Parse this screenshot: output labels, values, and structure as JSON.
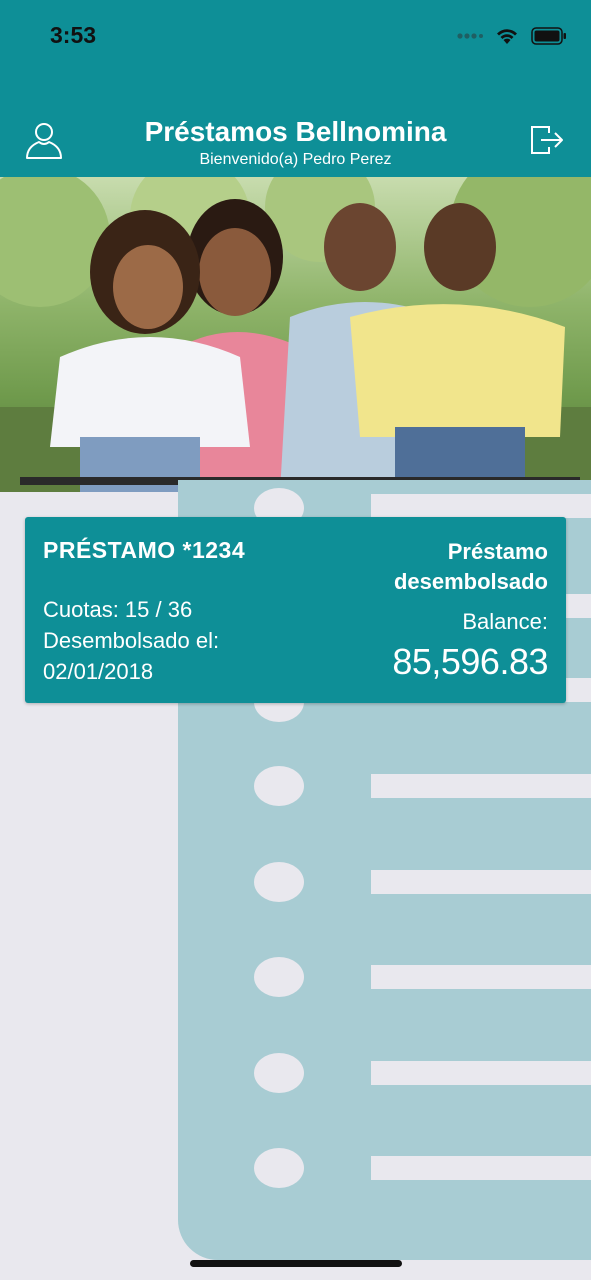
{
  "status_bar": {
    "time": "3:53",
    "icons": [
      "signal-dots-icon",
      "wifi-icon",
      "battery-icon"
    ]
  },
  "header": {
    "title": "Préstamos Bellnomina",
    "subtitle": "Bienvenido(a) Pedro Perez",
    "left_icon": "user-profile-icon",
    "right_icon": "logout-icon"
  },
  "hero": {
    "image": "family-photo"
  },
  "loan_card": {
    "id_label": "PRÉSTAMO *1234",
    "status": "Préstamo desembolsado",
    "cuotas": "Cuotas: 15 / 36",
    "disbursed_label": "Desembolsado el:",
    "disbursed_date": "02/01/2018",
    "balance_label": "Balance:",
    "balance_value": "85,596.83"
  },
  "colors": {
    "primary": "#0e8f97",
    "background": "#e9e8ee",
    "ledger": "#a8ccd3"
  }
}
